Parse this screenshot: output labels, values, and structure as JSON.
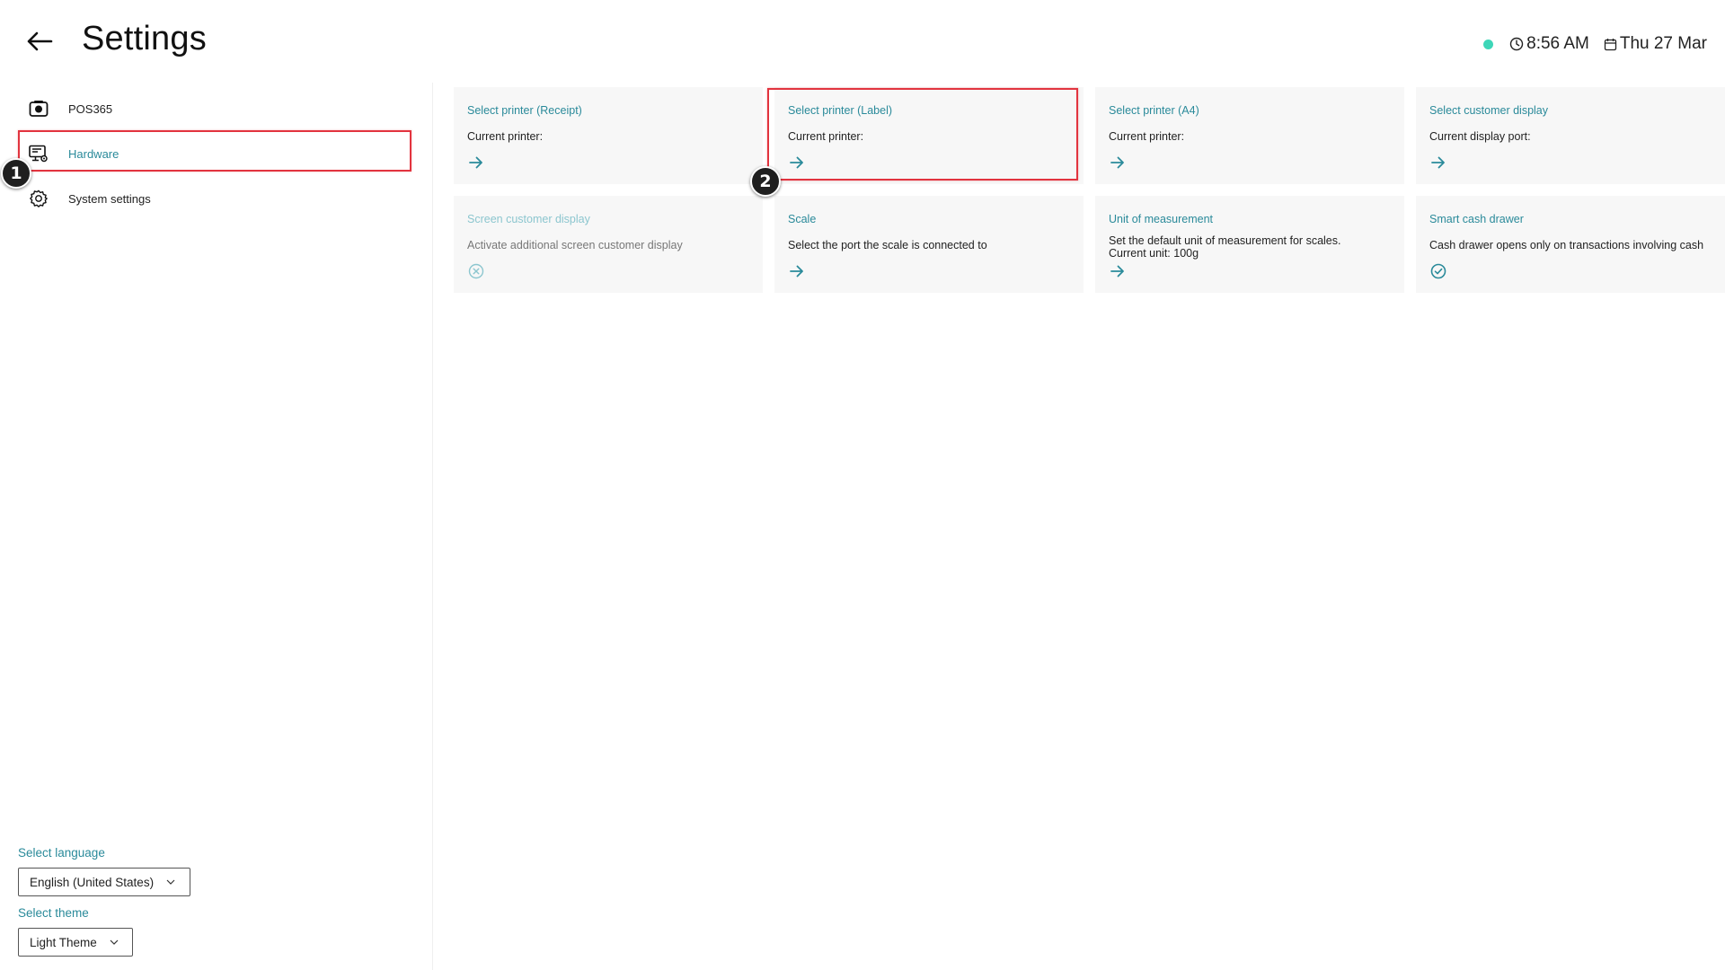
{
  "header": {
    "title": "Settings",
    "time": "8:56 AM",
    "date": "Thu 27 Mar",
    "status_color": "#3ed6b8"
  },
  "sidebar": {
    "items": [
      {
        "label": "POS365",
        "icon": "camera-icon"
      },
      {
        "label": "Hardware",
        "icon": "monitor-settings-icon",
        "active": true
      },
      {
        "label": "System settings",
        "icon": "gear-icon"
      }
    ],
    "language_label": "Select language",
    "language_value": "English (United States)",
    "theme_label": "Select theme",
    "theme_value": "Light Theme"
  },
  "cards": [
    {
      "title": "Select printer (Receipt)",
      "desc": "Current printer:",
      "action": "arrow-right-icon"
    },
    {
      "title": "Select printer (Label)",
      "desc": "Current printer:",
      "action": "arrow-right-icon"
    },
    {
      "title": "Select printer (A4)",
      "desc": "Current printer:",
      "action": "arrow-right-icon"
    },
    {
      "title": "Select customer display",
      "desc": "Current display port:",
      "action": "arrow-right-icon"
    },
    {
      "title": "Screen customer display",
      "desc": "Activate additional screen customer display",
      "action": "close-circle-icon",
      "disabled": true
    },
    {
      "title": "Scale",
      "desc": "Select the port the scale is connected to",
      "action": "arrow-right-icon"
    },
    {
      "title": "Unit of measurement",
      "desc_line1": "Set the default unit of measurement for scales.",
      "desc_line2": "Current unit: 100g",
      "action": "arrow-right-icon"
    },
    {
      "title": "Smart cash drawer",
      "desc": "Cash drawer opens only on transactions involving cash",
      "action": "check-circle-icon"
    }
  ],
  "annotations": {
    "step1": "1",
    "step2": "2",
    "highlight_color": "#e2343f"
  },
  "colors": {
    "accent": "#2a8a9a",
    "card_bg": "#f7f7f7"
  }
}
